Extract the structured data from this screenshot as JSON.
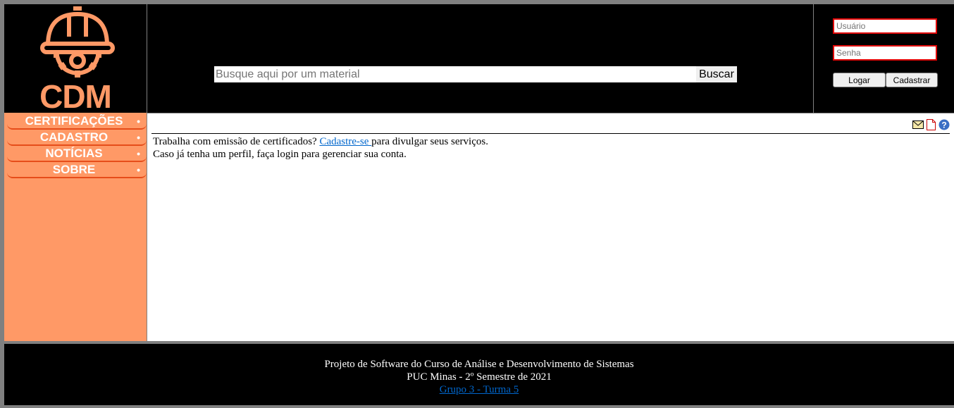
{
  "brand": {
    "name": "CDM",
    "primary": "#ff9966",
    "accent": "#e64d1a"
  },
  "search": {
    "placeholder": "Busque aqui por um material",
    "button_label": "Buscar"
  },
  "login": {
    "user_placeholder": "Usuário",
    "password_placeholder": "Senha",
    "login_label": "Logar",
    "register_label": "Cadastrar"
  },
  "nav": {
    "items": [
      {
        "label": "CERTIFICAÇÕES",
        "dot": "•"
      },
      {
        "label": "CADASTRO",
        "dot": "•"
      },
      {
        "label": "NOTÍCIAS",
        "dot": "•"
      },
      {
        "label": "SOBRE",
        "dot": "•"
      }
    ]
  },
  "toolbar_icons": [
    "mail-icon",
    "document-icon",
    "help-icon"
  ],
  "content": {
    "line1_before": "Trabalha com emissão de certificados? ",
    "line1_link": "Cadastre-se ",
    "line1_after": "para divulgar seus serviços.",
    "line2": "Caso já tenha um perfil, faça login para gerenciar sua conta."
  },
  "footer": {
    "line1": "Projeto de Software do Curso de Análise e Desenvolvimento de Sistemas",
    "line2": "PUC Minas - 2º Semestre de 2021",
    "link": "Grupo 3 - Turma 5"
  }
}
